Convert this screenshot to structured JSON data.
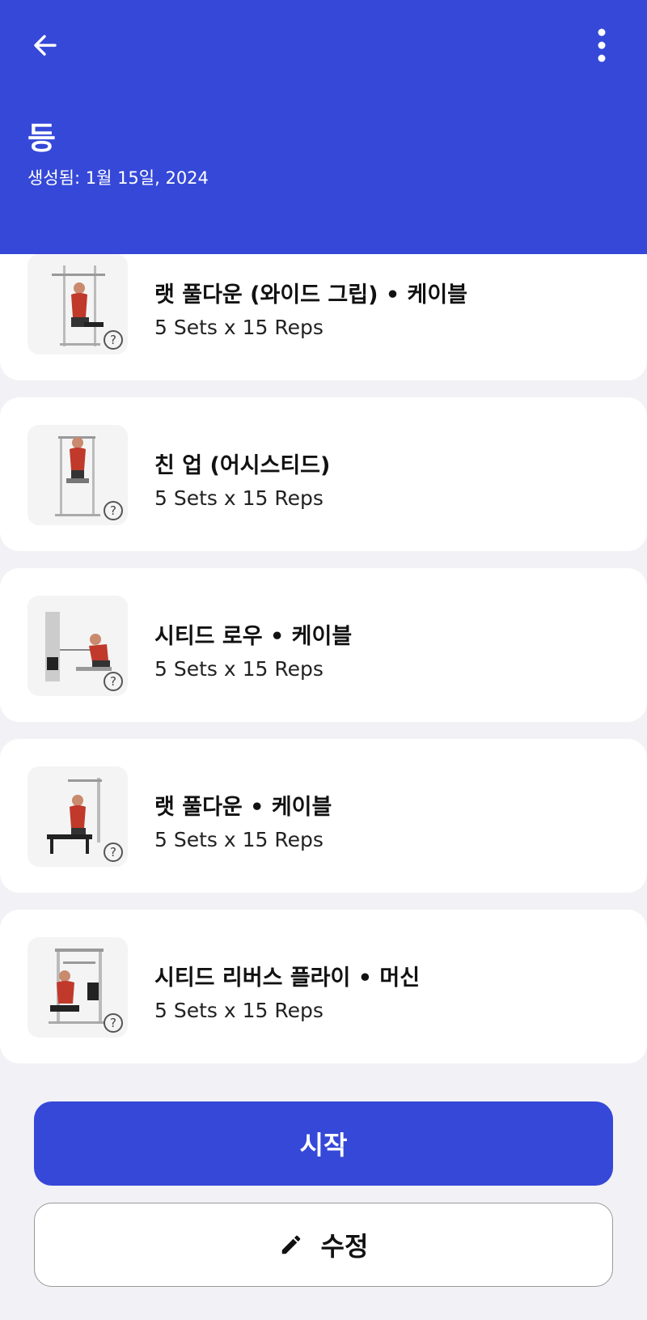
{
  "header": {
    "title": "등",
    "created": "생성됨: 1월 15일, 2024",
    "back_icon": "arrow-left-icon",
    "menu_icon": "more-vertical-icon",
    "color": "#3548d8"
  },
  "exercises": [
    {
      "name": "랫 풀다운 (와이드 그립) • 케이블",
      "detail": "5 Sets x 15 Reps"
    },
    {
      "name": "친 업 (어시스티드)",
      "detail": "5 Sets x 15 Reps"
    },
    {
      "name": "시티드 로우 • 케이블",
      "detail": "5 Sets x 15 Reps"
    },
    {
      "name": "랫 풀다운 • 케이블",
      "detail": "5 Sets x 15 Reps"
    },
    {
      "name": "시티드 리버스 플라이 • 머신",
      "detail": "5 Sets x 15 Reps"
    }
  ],
  "help_glyph": "?",
  "actions": {
    "start_label": "시작",
    "edit_label": "수정",
    "edit_icon": "pencil-icon"
  }
}
